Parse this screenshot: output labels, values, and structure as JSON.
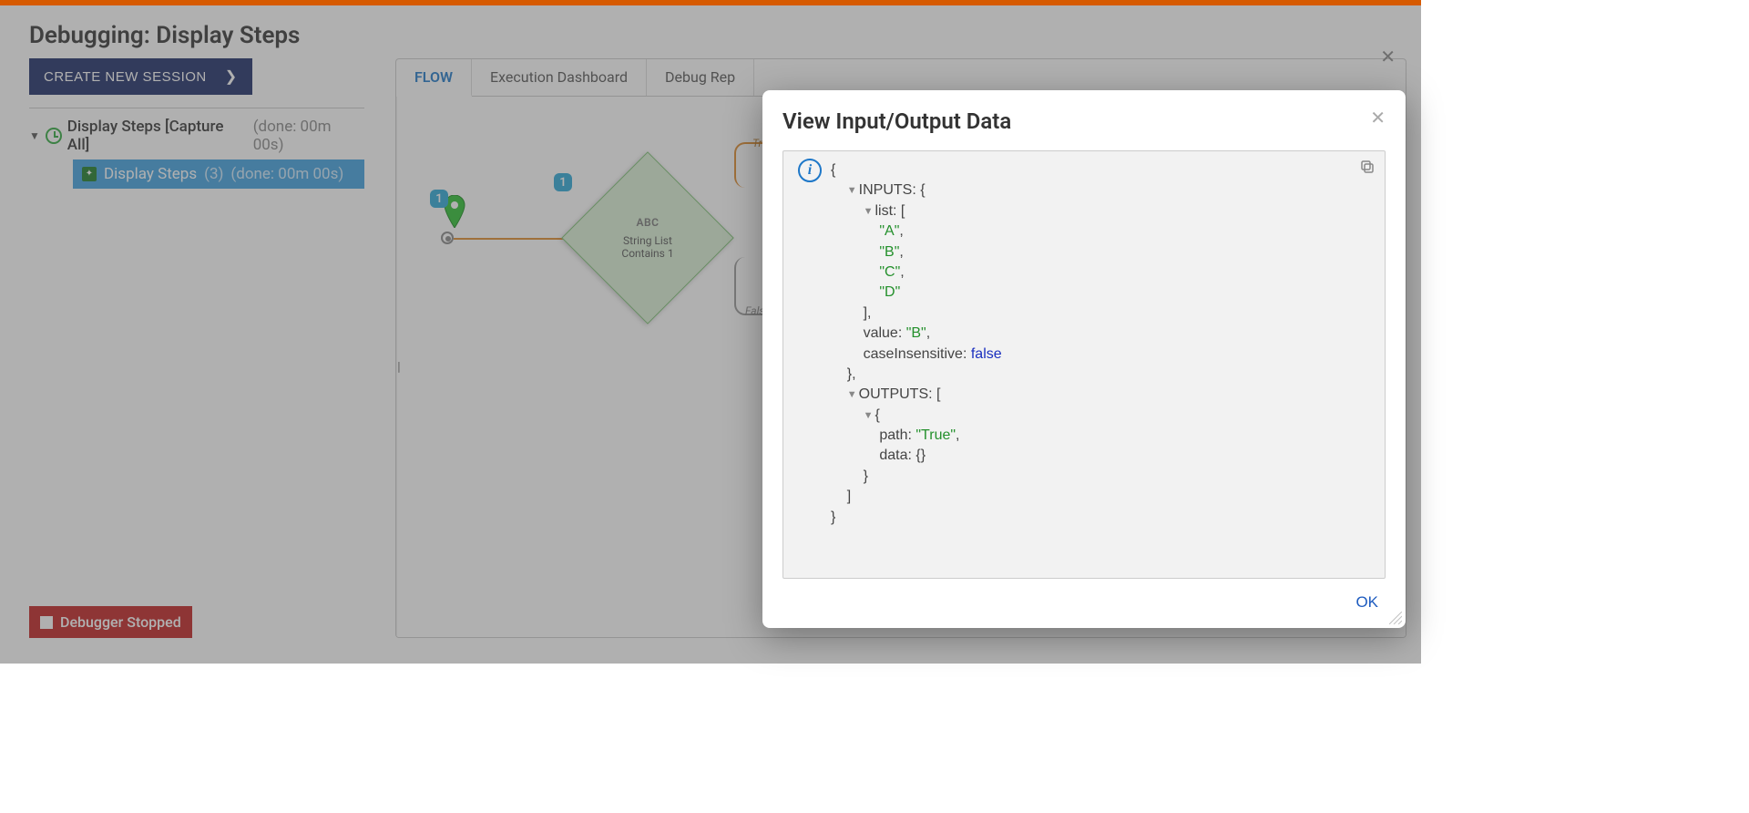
{
  "page_title": "Debugging: Display Steps",
  "sidebar": {
    "create_btn": "CREATE NEW SESSION",
    "session": {
      "name": "Display Steps [Capture All]",
      "done": "(done: 00m 00s)"
    },
    "step": {
      "name": "Display Steps",
      "count": "(3)",
      "done": "(done: 00m 00s)"
    },
    "debugger_status": "Debugger Stopped"
  },
  "tabs": {
    "flow": "FLOW",
    "exec": "Execution Dashboard",
    "debug": "Debug Rep"
  },
  "flow": {
    "badge_start": "1",
    "badge_diamond": "1",
    "diamond_label_top": "ABC",
    "diamond_label_main": "String List\nContains 1",
    "branch_true": "Tru",
    "branch_false": "False"
  },
  "modal": {
    "title": "View Input/Output Data",
    "ok": "OK",
    "json": {
      "lines": [
        {
          "indent": 0,
          "disclosure": false,
          "text_segments": [
            [
              "plain",
              "{"
            ]
          ]
        },
        {
          "indent": 1,
          "disclosure": true,
          "text_segments": [
            [
              "key",
              "INPUTS"
            ],
            [
              "plain",
              ": {"
            ]
          ]
        },
        {
          "indent": 2,
          "disclosure": true,
          "text_segments": [
            [
              "key",
              "list"
            ],
            [
              "plain",
              ": ["
            ]
          ]
        },
        {
          "indent": 3,
          "disclosure": false,
          "text_segments": [
            [
              "str",
              "\"A\""
            ],
            [
              "plain",
              ","
            ]
          ]
        },
        {
          "indent": 3,
          "disclosure": false,
          "text_segments": [
            [
              "str",
              "\"B\""
            ],
            [
              "plain",
              ","
            ]
          ]
        },
        {
          "indent": 3,
          "disclosure": false,
          "text_segments": [
            [
              "str",
              "\"C\""
            ],
            [
              "plain",
              ","
            ]
          ]
        },
        {
          "indent": 3,
          "disclosure": false,
          "text_segments": [
            [
              "str",
              "\"D\""
            ]
          ]
        },
        {
          "indent": 2,
          "disclosure": false,
          "text_segments": [
            [
              "plain",
              "],"
            ]
          ]
        },
        {
          "indent": 2,
          "disclosure": false,
          "text_segments": [
            [
              "key",
              "value"
            ],
            [
              "plain",
              ": "
            ],
            [
              "str",
              "\"B\""
            ],
            [
              "plain",
              ","
            ]
          ]
        },
        {
          "indent": 2,
          "disclosure": false,
          "text_segments": [
            [
              "key",
              "caseInsensitive"
            ],
            [
              "plain",
              ": "
            ],
            [
              "bool",
              "false"
            ]
          ]
        },
        {
          "indent": 1,
          "disclosure": false,
          "text_segments": [
            [
              "plain",
              "},"
            ]
          ]
        },
        {
          "indent": 1,
          "disclosure": true,
          "text_segments": [
            [
              "key",
              "OUTPUTS"
            ],
            [
              "plain",
              ": ["
            ]
          ]
        },
        {
          "indent": 2,
          "disclosure": true,
          "text_segments": [
            [
              "plain",
              "{"
            ]
          ]
        },
        {
          "indent": 3,
          "disclosure": false,
          "text_segments": [
            [
              "key",
              "path"
            ],
            [
              "plain",
              ": "
            ],
            [
              "str",
              "\"True\""
            ],
            [
              "plain",
              ","
            ]
          ]
        },
        {
          "indent": 3,
          "disclosure": false,
          "text_segments": [
            [
              "key",
              "data"
            ],
            [
              "plain",
              ": {}"
            ]
          ]
        },
        {
          "indent": 2,
          "disclosure": false,
          "text_segments": [
            [
              "plain",
              "}"
            ]
          ]
        },
        {
          "indent": 1,
          "disclosure": false,
          "text_segments": [
            [
              "plain",
              "]"
            ]
          ]
        },
        {
          "indent": 0,
          "disclosure": false,
          "text_segments": [
            [
              "plain",
              "}"
            ]
          ]
        }
      ]
    }
  }
}
